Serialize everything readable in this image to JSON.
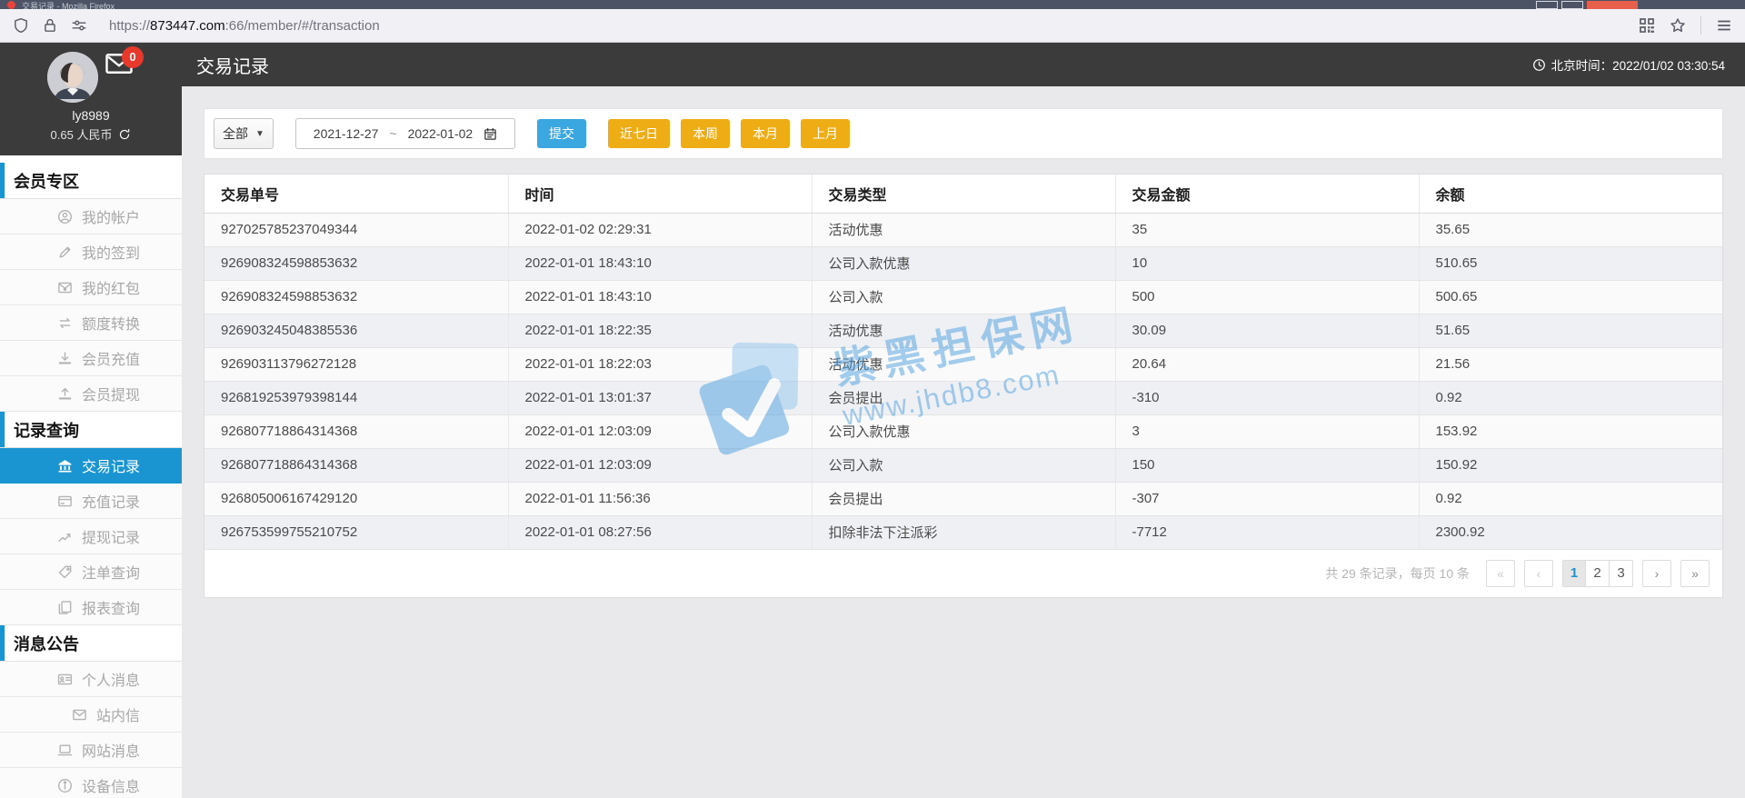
{
  "browser": {
    "tab_title": "交易记录 - Mozilla Firefox",
    "url_protocol": "https://",
    "url_domain": "873447.com",
    "url_rest": ":66/member/#/transaction",
    "toolbar_icons": [
      "shield-icon",
      "lock-icon",
      "permissions-icon",
      "qr-code-icon",
      "bookmark-star-icon",
      "menu-icon"
    ]
  },
  "header": {
    "title": "交易记录",
    "beijing_time": "北京时间：2022/01/02 03:30:54"
  },
  "user": {
    "name": "ly8989",
    "balance": "0.65 人民币",
    "unread_badge": "0"
  },
  "sidebar": {
    "sections": [
      {
        "title": "会员专区",
        "items": [
          {
            "id": "my-account",
            "icon": "user-icon",
            "label": "我的帐户",
            "active": false
          },
          {
            "id": "my-checkin",
            "icon": "pencil-icon",
            "label": "我的签到",
            "active": false
          },
          {
            "id": "my-redpacket",
            "icon": "redpacket-icon",
            "label": "我的红包",
            "active": false
          },
          {
            "id": "quota-convert",
            "icon": "exchange-icon",
            "label": "额度转换",
            "active": false
          },
          {
            "id": "member-deposit",
            "icon": "deposit-icon",
            "label": "会员充值",
            "active": false
          },
          {
            "id": "member-withdraw",
            "icon": "withdraw-icon",
            "label": "会员提现",
            "active": false
          }
        ]
      },
      {
        "title": "记录查询",
        "items": [
          {
            "id": "transaction-records",
            "icon": "bank-icon",
            "label": "交易记录",
            "active": true
          },
          {
            "id": "deposit-records",
            "icon": "card-icon",
            "label": "充值记录",
            "active": false
          },
          {
            "id": "withdraw-records",
            "icon": "chart-icon",
            "label": "提现记录",
            "active": false
          },
          {
            "id": "bet-query",
            "icon": "tag-icon",
            "label": "注单查询",
            "active": false
          },
          {
            "id": "report-query",
            "icon": "report-icon",
            "label": "报表查询",
            "active": false
          }
        ]
      },
      {
        "title": "消息公告",
        "items": [
          {
            "id": "personal-messages",
            "icon": "idcard-icon",
            "label": "个人消息",
            "active": false
          },
          {
            "id": "site-mail",
            "icon": "envelope-icon",
            "label": "站内信",
            "active": false
          },
          {
            "id": "site-messages",
            "icon": "laptop-icon",
            "label": "网站消息",
            "active": false
          },
          {
            "id": "device-info",
            "icon": "info-icon",
            "label": "设备信息",
            "active": false
          }
        ]
      }
    ]
  },
  "filters": {
    "type_select": "全部",
    "date_start": "2021-12-27",
    "date_separator": "~",
    "date_end": "2022-01-02",
    "submit": "提交",
    "quick": [
      "近七日",
      "本周",
      "本月",
      "上月"
    ]
  },
  "table": {
    "columns": [
      "交易单号",
      "时间",
      "交易类型",
      "交易金额",
      "余额"
    ],
    "rows": [
      [
        "927025785237049344",
        "2022-01-02 02:29:31",
        "活动优惠",
        "35",
        "35.65"
      ],
      [
        "926908324598853632",
        "2022-01-01 18:43:10",
        "公司入款优惠",
        "10",
        "510.65"
      ],
      [
        "926908324598853632",
        "2022-01-01 18:43:10",
        "公司入款",
        "500",
        "500.65"
      ],
      [
        "926903245048385536",
        "2022-01-01 18:22:35",
        "活动优惠",
        "30.09",
        "51.65"
      ],
      [
        "926903113796272128",
        "2022-01-01 18:22:03",
        "活动优惠",
        "20.64",
        "21.56"
      ],
      [
        "926819253979398144",
        "2022-01-01 13:01:37",
        "会员提出",
        "-310",
        "0.92"
      ],
      [
        "926807718864314368",
        "2022-01-01 12:03:09",
        "公司入款优惠",
        "3",
        "153.92"
      ],
      [
        "926807718864314368",
        "2022-01-01 12:03:09",
        "公司入款",
        "150",
        "150.92"
      ],
      [
        "926805006167429120",
        "2022-01-01 11:56:36",
        "会员提出",
        "-307",
        "0.92"
      ],
      [
        "926753599755210752",
        "2022-01-01 08:27:56",
        "扣除非法下注派彩",
        "-7712",
        "2300.92"
      ]
    ]
  },
  "pagination": {
    "summary": "共 29 条记录，每页 10 条",
    "first": "«",
    "prev": "‹",
    "pages": [
      "1",
      "2",
      "3"
    ],
    "active_page": "1",
    "next": "›",
    "last": "»"
  },
  "watermark": {
    "line1": "紫黑担保网",
    "line2": "www.jhdb8.com"
  },
  "colors": {
    "accent_blue": "#1b95d2",
    "submit_blue": "#3ba7e0",
    "quick_yellow": "#efad15",
    "badge_red": "#e8382c",
    "header_dark": "#3b3b3b",
    "watermark_blue": "#4f9fdf"
  }
}
